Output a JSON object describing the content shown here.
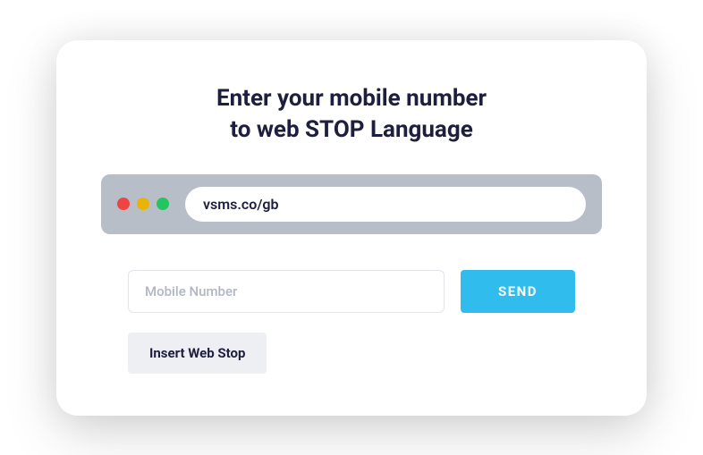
{
  "heading": {
    "line1": "Enter your mobile number",
    "line2": "to web STOP Language"
  },
  "browser": {
    "url": "vsms.co/gb"
  },
  "form": {
    "mobile_placeholder": "Mobile Number",
    "send_label": "SEND",
    "insert_label": "Insert Web Stop"
  }
}
